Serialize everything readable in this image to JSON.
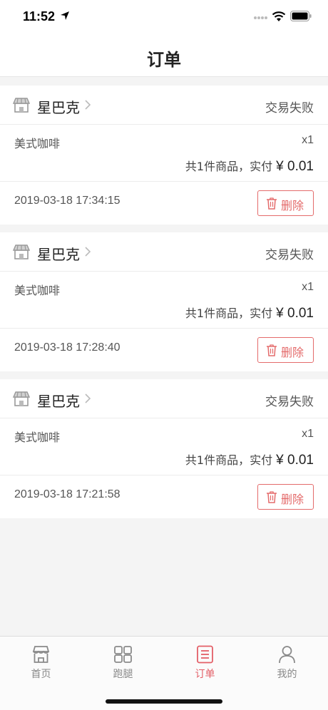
{
  "status_bar": {
    "time": "11:52"
  },
  "nav": {
    "title": "订单"
  },
  "orders": [
    {
      "store": "星巴克",
      "status": "交易失败",
      "product": "美式咖啡",
      "qty": "x1",
      "summary_text": "共1件商品，实付",
      "price": "¥ 0.01",
      "time": "2019-03-18 17:34:15",
      "delete_label": "删除"
    },
    {
      "store": "星巴克",
      "status": "交易失败",
      "product": "美式咖啡",
      "qty": "x1",
      "summary_text": "共1件商品，实付",
      "price": "¥ 0.01",
      "time": "2019-03-18 17:28:40",
      "delete_label": "删除"
    },
    {
      "store": "星巴克",
      "status": "交易失败",
      "product": "美式咖啡",
      "qty": "x1",
      "summary_text": "共1件商品，实付",
      "price": "¥ 0.01",
      "time": "2019-03-18 17:21:58",
      "delete_label": "删除"
    }
  ],
  "tabs": [
    {
      "label": "首页",
      "icon": "store-icon"
    },
    {
      "label": "跑腿",
      "icon": "grid-icon"
    },
    {
      "label": "订单",
      "icon": "order-list-icon",
      "active": true
    },
    {
      "label": "我的",
      "icon": "person-icon"
    }
  ],
  "colors": {
    "accent": "#e35f67",
    "delete": "#e46b6b",
    "background": "#f4f4f4"
  }
}
